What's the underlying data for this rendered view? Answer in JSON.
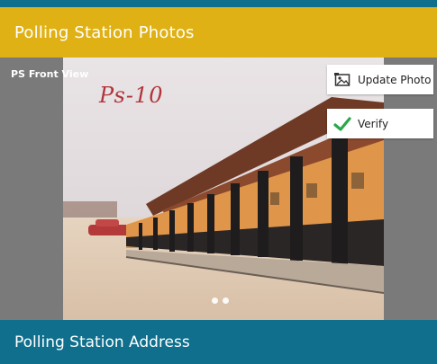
{
  "header": {
    "title": "Polling Station Photos"
  },
  "photo": {
    "label": "PS Front View",
    "handwritten_text": "Ps-10",
    "carousel_pages": 2
  },
  "actions": {
    "update_photo_label": "Update Photo",
    "verify_label": "Verify"
  },
  "footer": {
    "title": "Polling Station Address"
  },
  "colors": {
    "header_bg": "#e0b114",
    "footer_bg": "#0f6f8c",
    "verify_check": "#2aa84a"
  },
  "icons": {
    "update_photo": "photo-frame-icon",
    "verify": "check-icon"
  }
}
